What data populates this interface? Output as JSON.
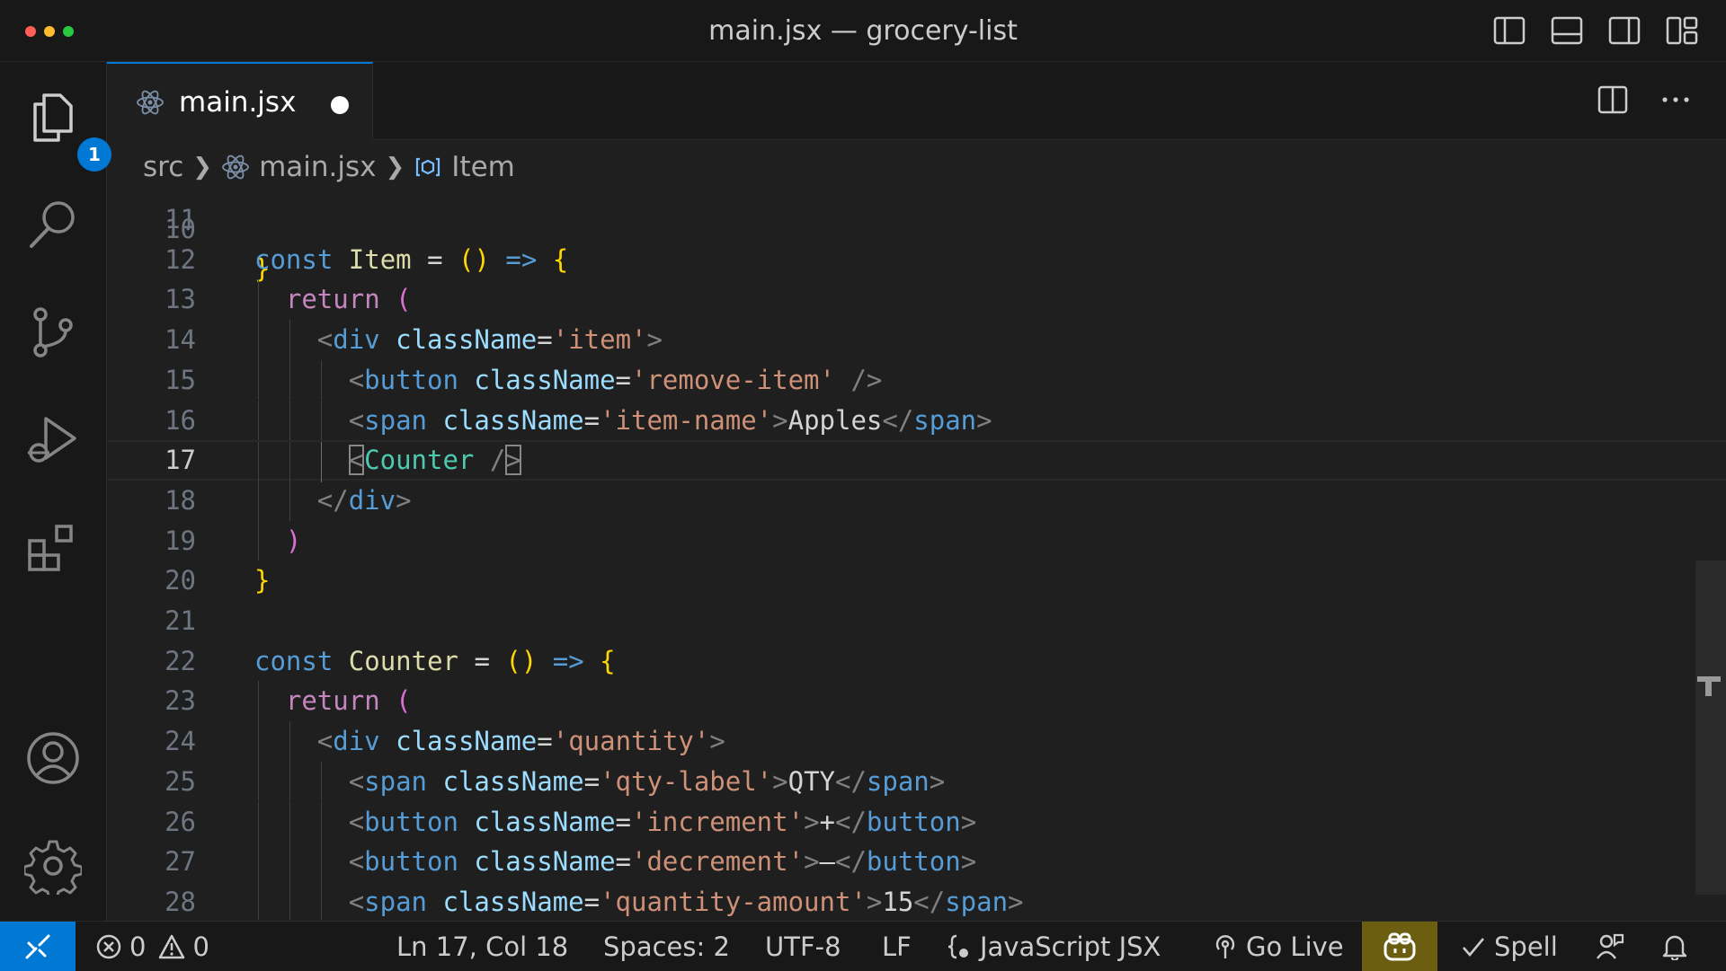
{
  "window": {
    "title": "main.jsx — grocery-list",
    "traffic_colors": [
      "#ff5f57",
      "#febc2e",
      "#28c840"
    ]
  },
  "activity_bar": {
    "items": [
      "explorer-icon",
      "search-icon",
      "source-control-icon",
      "run-debug-icon",
      "extensions-icon",
      "account-icon",
      "settings-gear-icon"
    ],
    "explorer_badge": "1"
  },
  "tab": {
    "label": "main.jsx",
    "modified": true
  },
  "breadcrumb": {
    "folder": "src",
    "file": "main.jsx",
    "symbol": "Item"
  },
  "editor": {
    "partial_top_line_number": "10",
    "active_line": 17,
    "lines": [
      {
        "n": "11",
        "indent": 0,
        "tokens": []
      },
      {
        "n": "12",
        "indent": 0,
        "tokens": [
          [
            "const",
            "kw"
          ],
          [
            " ",
            "txt"
          ],
          [
            "Item",
            "fn"
          ],
          [
            " = ",
            "txt"
          ],
          [
            "()",
            "br1"
          ],
          [
            " ",
            "txt"
          ],
          [
            "=>",
            "kw"
          ],
          [
            " ",
            "txt"
          ],
          [
            "{",
            "br1"
          ]
        ]
      },
      {
        "n": "13",
        "indent": 1,
        "tokens": [
          [
            "return",
            "ctrl"
          ],
          [
            " ",
            "txt"
          ],
          [
            "(",
            "br2"
          ]
        ]
      },
      {
        "n": "14",
        "indent": 2,
        "tokens": [
          [
            "<",
            "punc"
          ],
          [
            "div",
            "tag"
          ],
          [
            " ",
            "txt"
          ],
          [
            "className",
            "attr"
          ],
          [
            "=",
            "txt"
          ],
          [
            "'item'",
            "str"
          ],
          [
            ">",
            "punc"
          ]
        ]
      },
      {
        "n": "15",
        "indent": 3,
        "tokens": [
          [
            "<",
            "punc"
          ],
          [
            "button",
            "tag"
          ],
          [
            " ",
            "txt"
          ],
          [
            "className",
            "attr"
          ],
          [
            "=",
            "txt"
          ],
          [
            "'remove-item'",
            "str"
          ],
          [
            " ",
            "txt"
          ],
          [
            "/>",
            "punc"
          ]
        ]
      },
      {
        "n": "16",
        "indent": 3,
        "tokens": [
          [
            "<",
            "punc"
          ],
          [
            "span",
            "tag"
          ],
          [
            " ",
            "txt"
          ],
          [
            "className",
            "attr"
          ],
          [
            "=",
            "txt"
          ],
          [
            "'item-name'",
            "str"
          ],
          [
            ">",
            "punc"
          ],
          [
            "Apples",
            "txt"
          ],
          [
            "</",
            "punc"
          ],
          [
            "span",
            "tag"
          ],
          [
            ">",
            "punc"
          ]
        ]
      },
      {
        "n": "17",
        "indent": 3,
        "tokens": [
          [
            "<",
            "punc-box"
          ],
          [
            "Counter",
            "comp"
          ],
          [
            " ",
            "txt"
          ],
          [
            "/",
            "punc"
          ],
          [
            ">",
            "punc-box"
          ]
        ]
      },
      {
        "n": "18",
        "indent": 2,
        "tokens": [
          [
            "</",
            "punc"
          ],
          [
            "div",
            "tag"
          ],
          [
            ">",
            "punc"
          ]
        ]
      },
      {
        "n": "19",
        "indent": 1,
        "tokens": [
          [
            ")",
            "br2"
          ]
        ]
      },
      {
        "n": "20",
        "indent": 0,
        "tokens": [
          [
            "}",
            "br1"
          ]
        ]
      },
      {
        "n": "21",
        "indent": 0,
        "tokens": []
      },
      {
        "n": "22",
        "indent": 0,
        "tokens": [
          [
            "const",
            "kw"
          ],
          [
            " ",
            "txt"
          ],
          [
            "Counter",
            "fn"
          ],
          [
            " = ",
            "txt"
          ],
          [
            "()",
            "br1"
          ],
          [
            " ",
            "txt"
          ],
          [
            "=>",
            "kw"
          ],
          [
            " ",
            "txt"
          ],
          [
            "{",
            "br1"
          ]
        ]
      },
      {
        "n": "23",
        "indent": 1,
        "tokens": [
          [
            "return",
            "ctrl"
          ],
          [
            " ",
            "txt"
          ],
          [
            "(",
            "br2"
          ]
        ]
      },
      {
        "n": "24",
        "indent": 2,
        "tokens": [
          [
            "<",
            "punc"
          ],
          [
            "div",
            "tag"
          ],
          [
            " ",
            "txt"
          ],
          [
            "className",
            "attr"
          ],
          [
            "=",
            "txt"
          ],
          [
            "'quantity'",
            "str"
          ],
          [
            ">",
            "punc"
          ]
        ]
      },
      {
        "n": "25",
        "indent": 3,
        "tokens": [
          [
            "<",
            "punc"
          ],
          [
            "span",
            "tag"
          ],
          [
            " ",
            "txt"
          ],
          [
            "className",
            "attr"
          ],
          [
            "=",
            "txt"
          ],
          [
            "'qty-label'",
            "str"
          ],
          [
            ">",
            "punc"
          ],
          [
            "QTY",
            "txt"
          ],
          [
            "</",
            "punc"
          ],
          [
            "span",
            "tag"
          ],
          [
            ">",
            "punc"
          ]
        ]
      },
      {
        "n": "26",
        "indent": 3,
        "tokens": [
          [
            "<",
            "punc"
          ],
          [
            "button",
            "tag"
          ],
          [
            " ",
            "txt"
          ],
          [
            "className",
            "attr"
          ],
          [
            "=",
            "txt"
          ],
          [
            "'increment'",
            "str"
          ],
          [
            ">",
            "punc"
          ],
          [
            "+",
            "txt"
          ],
          [
            "</",
            "punc"
          ],
          [
            "button",
            "tag"
          ],
          [
            ">",
            "punc"
          ]
        ]
      },
      {
        "n": "27",
        "indent": 3,
        "tokens": [
          [
            "<",
            "punc"
          ],
          [
            "button",
            "tag"
          ],
          [
            " ",
            "txt"
          ],
          [
            "className",
            "attr"
          ],
          [
            "=",
            "txt"
          ],
          [
            "'decrement'",
            "str"
          ],
          [
            ">",
            "punc"
          ],
          [
            "–",
            "txt"
          ],
          [
            "</",
            "punc"
          ],
          [
            "button",
            "tag"
          ],
          [
            ">",
            "punc"
          ]
        ]
      },
      {
        "n": "28",
        "indent": 3,
        "tokens": [
          [
            "<",
            "punc"
          ],
          [
            "span",
            "tag"
          ],
          [
            " ",
            "txt"
          ],
          [
            "className",
            "attr"
          ],
          [
            "=",
            "txt"
          ],
          [
            "'quantity-amount'",
            "str"
          ],
          [
            ">",
            "punc"
          ],
          [
            "15",
            "txt"
          ],
          [
            "</",
            "punc"
          ],
          [
            "span",
            "tag"
          ],
          [
            ">",
            "punc"
          ]
        ]
      }
    ]
  },
  "status_bar": {
    "errors": "0",
    "warnings": "0",
    "cursor": "Ln 17, Col 18",
    "spaces": "Spaces: 2",
    "encoding": "UTF-8",
    "eol": "LF",
    "language": "JavaScript JSX",
    "go_live": "Go Live",
    "spell": "Spell"
  },
  "colors": {
    "accent": "#0078d4",
    "copilot_bg": "#6b5e10"
  }
}
